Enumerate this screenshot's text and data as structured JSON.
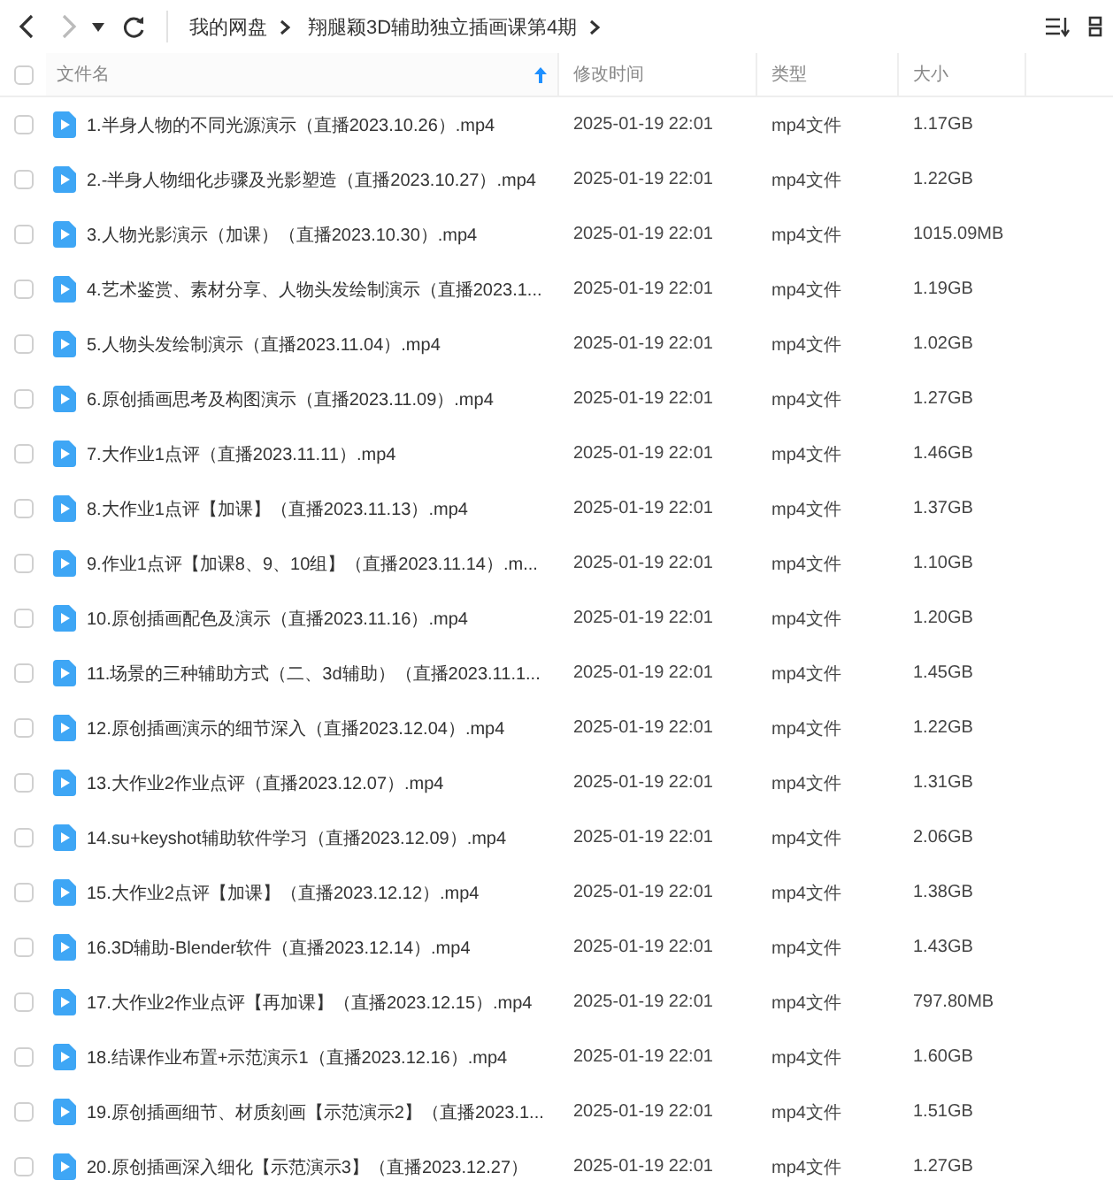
{
  "toolbar": {
    "back": {
      "disabled": false
    },
    "forward": {
      "disabled": true
    },
    "breadcrumb": [
      {
        "label": "我的网盘"
      },
      {
        "label": "翔腿颖3D辅助独立插画课第4期"
      }
    ]
  },
  "table": {
    "select_all": {
      "checked": false
    },
    "columns": [
      {
        "label": "文件名",
        "sorted": true
      },
      {
        "label": "修改时间",
        "sorted": false
      },
      {
        "label": "类型",
        "sorted": false
      },
      {
        "label": "大小",
        "sorted": false
      }
    ],
    "rows": [
      {
        "checked": false,
        "name": "1.半身人物的不同光源演示（直播2023.10.26）.mp4",
        "modified": "2025-01-19 22:01",
        "type": "mp4文件",
        "size": "1.17GB"
      },
      {
        "checked": false,
        "name": "2.-半身人物细化步骤及光影塑造（直播2023.10.27）.mp4",
        "modified": "2025-01-19 22:01",
        "type": "mp4文件",
        "size": "1.22GB"
      },
      {
        "checked": false,
        "name": "3.人物光影演示（加课）（直播2023.10.30）.mp4",
        "modified": "2025-01-19 22:01",
        "type": "mp4文件",
        "size": "1015.09MB"
      },
      {
        "checked": false,
        "name": "4.艺术鉴赏、素材分享、人物头发绘制演示（直播2023.1...",
        "modified": "2025-01-19 22:01",
        "type": "mp4文件",
        "size": "1.19GB"
      },
      {
        "checked": false,
        "name": "5.人物头发绘制演示（直播2023.11.04）.mp4",
        "modified": "2025-01-19 22:01",
        "type": "mp4文件",
        "size": "1.02GB"
      },
      {
        "checked": false,
        "name": "6.原创插画思考及构图演示（直播2023.11.09）.mp4",
        "modified": "2025-01-19 22:01",
        "type": "mp4文件",
        "size": "1.27GB"
      },
      {
        "checked": false,
        "name": "7.大作业1点评（直播2023.11.11）.mp4",
        "modified": "2025-01-19 22:01",
        "type": "mp4文件",
        "size": "1.46GB"
      },
      {
        "checked": false,
        "name": "8.大作业1点评【加课】（直播2023.11.13）.mp4",
        "modified": "2025-01-19 22:01",
        "type": "mp4文件",
        "size": "1.37GB"
      },
      {
        "checked": false,
        "name": "9.作业1点评【加课8、9、10组】（直播2023.11.14）.m...",
        "modified": "2025-01-19 22:01",
        "type": "mp4文件",
        "size": "1.10GB"
      },
      {
        "checked": false,
        "name": "10.原创插画配色及演示（直播2023.11.16）.mp4",
        "modified": "2025-01-19 22:01",
        "type": "mp4文件",
        "size": "1.20GB"
      },
      {
        "checked": false,
        "name": "11.场景的三种辅助方式（二、3d辅助）（直播2023.11.1...",
        "modified": "2025-01-19 22:01",
        "type": "mp4文件",
        "size": "1.45GB"
      },
      {
        "checked": false,
        "name": "12.原创插画演示的细节深入（直播2023.12.04）.mp4",
        "modified": "2025-01-19 22:01",
        "type": "mp4文件",
        "size": "1.22GB"
      },
      {
        "checked": false,
        "name": "13.大作业2作业点评（直播2023.12.07）.mp4",
        "modified": "2025-01-19 22:01",
        "type": "mp4文件",
        "size": "1.31GB"
      },
      {
        "checked": false,
        "name": "14.su+keyshot辅助软件学习（直播2023.12.09）.mp4",
        "modified": "2025-01-19 22:01",
        "type": "mp4文件",
        "size": "2.06GB"
      },
      {
        "checked": false,
        "name": "15.大作业2点评【加课】（直播2023.12.12）.mp4",
        "modified": "2025-01-19 22:01",
        "type": "mp4文件",
        "size": "1.38GB"
      },
      {
        "checked": false,
        "name": "16.3D辅助-Blender软件（直播2023.12.14）.mp4",
        "modified": "2025-01-19 22:01",
        "type": "mp4文件",
        "size": "1.43GB"
      },
      {
        "checked": false,
        "name": "17.大作业2作业点评【再加课】（直播2023.12.15）.mp4",
        "modified": "2025-01-19 22:01",
        "type": "mp4文件",
        "size": "797.80MB"
      },
      {
        "checked": false,
        "name": "18.结课作业布置+示范演示1（直播2023.12.16）.mp4",
        "modified": "2025-01-19 22:01",
        "type": "mp4文件",
        "size": "1.60GB"
      },
      {
        "checked": false,
        "name": "19.原创插画细节、材质刻画【示范演示2】（直播2023.1...",
        "modified": "2025-01-19 22:01",
        "type": "mp4文件",
        "size": "1.51GB"
      },
      {
        "checked": false,
        "name": "20.原创插画深入细化【示范演示3】（直播2023.12.27）",
        "modified": "2025-01-19 22:01",
        "type": "mp4文件",
        "size": "1.27GB"
      }
    ]
  }
}
